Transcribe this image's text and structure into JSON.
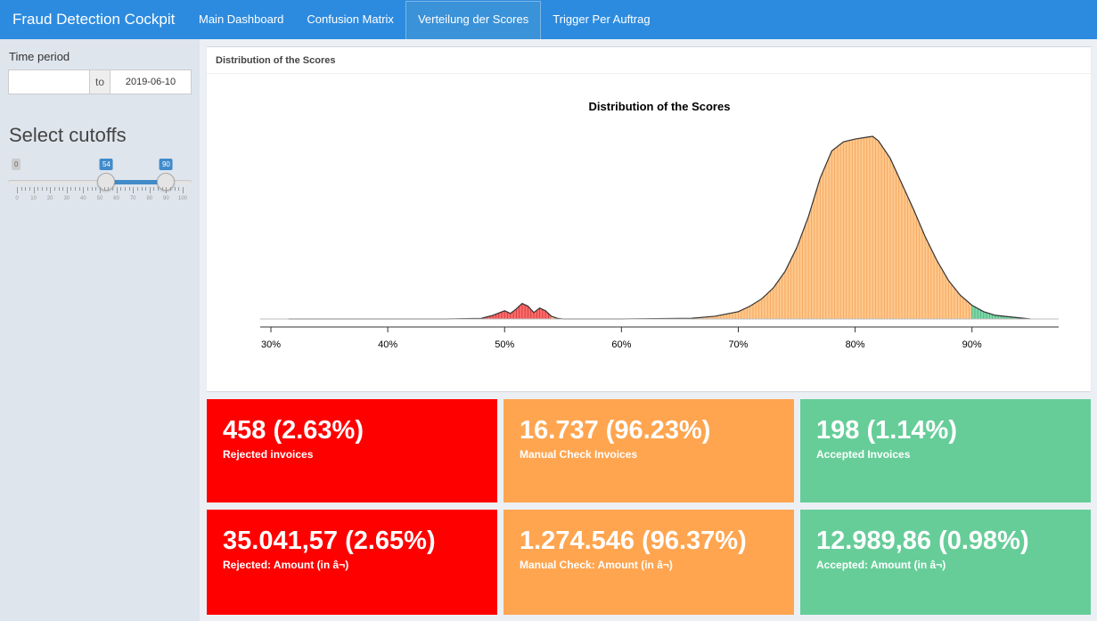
{
  "brand": "Fraud Detection Cockpit",
  "tabs": [
    "Main Dashboard",
    "Confusion Matrix",
    "Verteilung der Scores",
    "Trigger Per Auftrag"
  ],
  "active_tab": 2,
  "sidebar": {
    "time_label": "Time period",
    "date_start": "",
    "date_sep": "to",
    "date_end": "2019-06-10",
    "cutoffs_label": "Select cutoffs",
    "slider": {
      "min": 0,
      "max": 100,
      "low": 54,
      "high": 90,
      "min_badge": "0",
      "low_badge": "54",
      "high_badge": "90",
      "tick_labels": [
        "0",
        "10",
        "20",
        "30",
        "40",
        "50",
        "60",
        "70",
        "80",
        "90",
        "100"
      ]
    }
  },
  "plot_box": {
    "header": "Distribution of the Scores"
  },
  "chart_data": {
    "type": "area",
    "title": "Distribution of the Scores",
    "xlabel": "",
    "ylabel": "",
    "xlim": [
      0.29,
      0.97
    ],
    "x_ticks": [
      0.3,
      0.4,
      0.5,
      0.6,
      0.7,
      0.8,
      0.9
    ],
    "x_tick_labels": [
      "30%",
      "40%",
      "50%",
      "60%",
      "70%",
      "80%",
      "90%"
    ],
    "cutoffs": [
      0.54,
      0.9
    ],
    "colors": {
      "rejected": "#ff6a6a",
      "manual": "#ffc88c",
      "accepted": "#7dd8a8",
      "line": "#333333"
    },
    "x": [
      0.315,
      0.35,
      0.4,
      0.45,
      0.48,
      0.49,
      0.5,
      0.505,
      0.51,
      0.515,
      0.52,
      0.525,
      0.53,
      0.535,
      0.54,
      0.545,
      0.55,
      0.6,
      0.66,
      0.68,
      0.7,
      0.71,
      0.72,
      0.73,
      0.74,
      0.75,
      0.76,
      0.77,
      0.78,
      0.79,
      0.8,
      0.81,
      0.815,
      0.82,
      0.83,
      0.84,
      0.85,
      0.86,
      0.87,
      0.88,
      0.89,
      0.9,
      0.91,
      0.92,
      0.95
    ],
    "y": [
      0.0,
      0.0,
      0.0,
      0.0,
      0.003,
      0.02,
      0.045,
      0.03,
      0.055,
      0.085,
      0.07,
      0.035,
      0.06,
      0.045,
      0.015,
      0.004,
      0.0,
      0.0,
      0.004,
      0.015,
      0.04,
      0.07,
      0.11,
      0.17,
      0.26,
      0.39,
      0.56,
      0.77,
      0.92,
      0.97,
      0.985,
      0.995,
      1.0,
      0.975,
      0.88,
      0.74,
      0.6,
      0.45,
      0.32,
      0.21,
      0.13,
      0.075,
      0.04,
      0.02,
      0.0
    ]
  },
  "value_boxes": [
    {
      "value": "458 (2.63%)",
      "label": "Rejected invoices",
      "color": "red"
    },
    {
      "value": "16.737 (96.23%)",
      "label": "Manual Check Invoices",
      "color": "orange"
    },
    {
      "value": "198 (1.14%)",
      "label": "Accepted Invoices",
      "color": "green"
    },
    {
      "value": "35.041,57 (2.65%)",
      "label": "Rejected: Amount (in â¬)",
      "color": "red"
    },
    {
      "value": "1.274.546 (96.37%)",
      "label": "Manual Check: Amount (in â¬)",
      "color": "orange"
    },
    {
      "value": "12.989,86 (0.98%)",
      "label": "Accepted: Amount (in â¬)",
      "color": "green"
    }
  ]
}
